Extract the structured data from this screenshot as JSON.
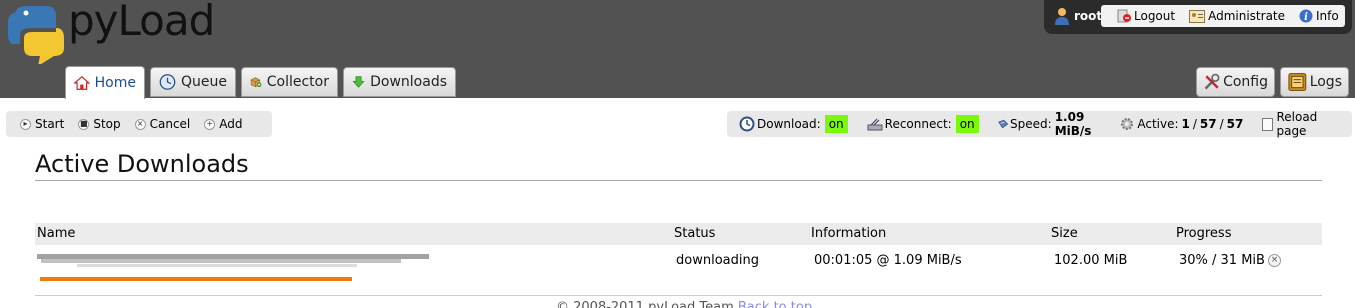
{
  "app": {
    "name": "pyLoad"
  },
  "userbar": {
    "username": "root",
    "links": [
      {
        "label": "Logout",
        "icon": "logout-icon"
      },
      {
        "label": "Administrate",
        "icon": "administrate-icon"
      },
      {
        "label": "Info",
        "icon": "info-icon"
      }
    ]
  },
  "tabs": [
    {
      "label": "Home",
      "icon": "home-icon",
      "active": true
    },
    {
      "label": "Queue",
      "icon": "clock-icon"
    },
    {
      "label": "Collector",
      "icon": "package-add-icon"
    },
    {
      "label": "Downloads",
      "icon": "download-arrow-icon"
    }
  ],
  "right_tabs": [
    {
      "label": "Config",
      "icon": "tools-icon"
    },
    {
      "label": "Logs",
      "icon": "logs-icon"
    }
  ],
  "toolbar": {
    "start": "Start",
    "stop": "Stop",
    "cancel": "Cancel",
    "add": "Add"
  },
  "status": {
    "download_label": "Download:",
    "download_value": "on",
    "reconnect_label": "Reconnect:",
    "reconnect_value": "on",
    "speed_label": "Speed:",
    "speed_value": "1.09 MiB/s",
    "active_label": "Active:",
    "active_current": "1",
    "sep1": "/",
    "active_queued": "57",
    "sep2": "/",
    "active_total": "57",
    "reload_label": "Reload page"
  },
  "main": {
    "title": "Active Downloads",
    "columns": [
      "Name",
      "Status",
      "Information",
      "Size",
      "Progress"
    ],
    "rows": [
      {
        "name": "",
        "status": "downloading",
        "information": "00:01:05 @ 1.09 MiB/s",
        "size": "102.00 MiB",
        "progress_text": "30% / 31 MiB",
        "progress_fraction": 0.3
      }
    ]
  },
  "footer": {
    "copyright": "© 2008-2011 pyLoad Team",
    "back_to_top": "Back to top"
  },
  "colors": {
    "header_bg": "#525252",
    "on_badge": "#7cf80d",
    "progress_bar": "#ef7d0d",
    "active_tab_text": "#1a4d9c"
  }
}
